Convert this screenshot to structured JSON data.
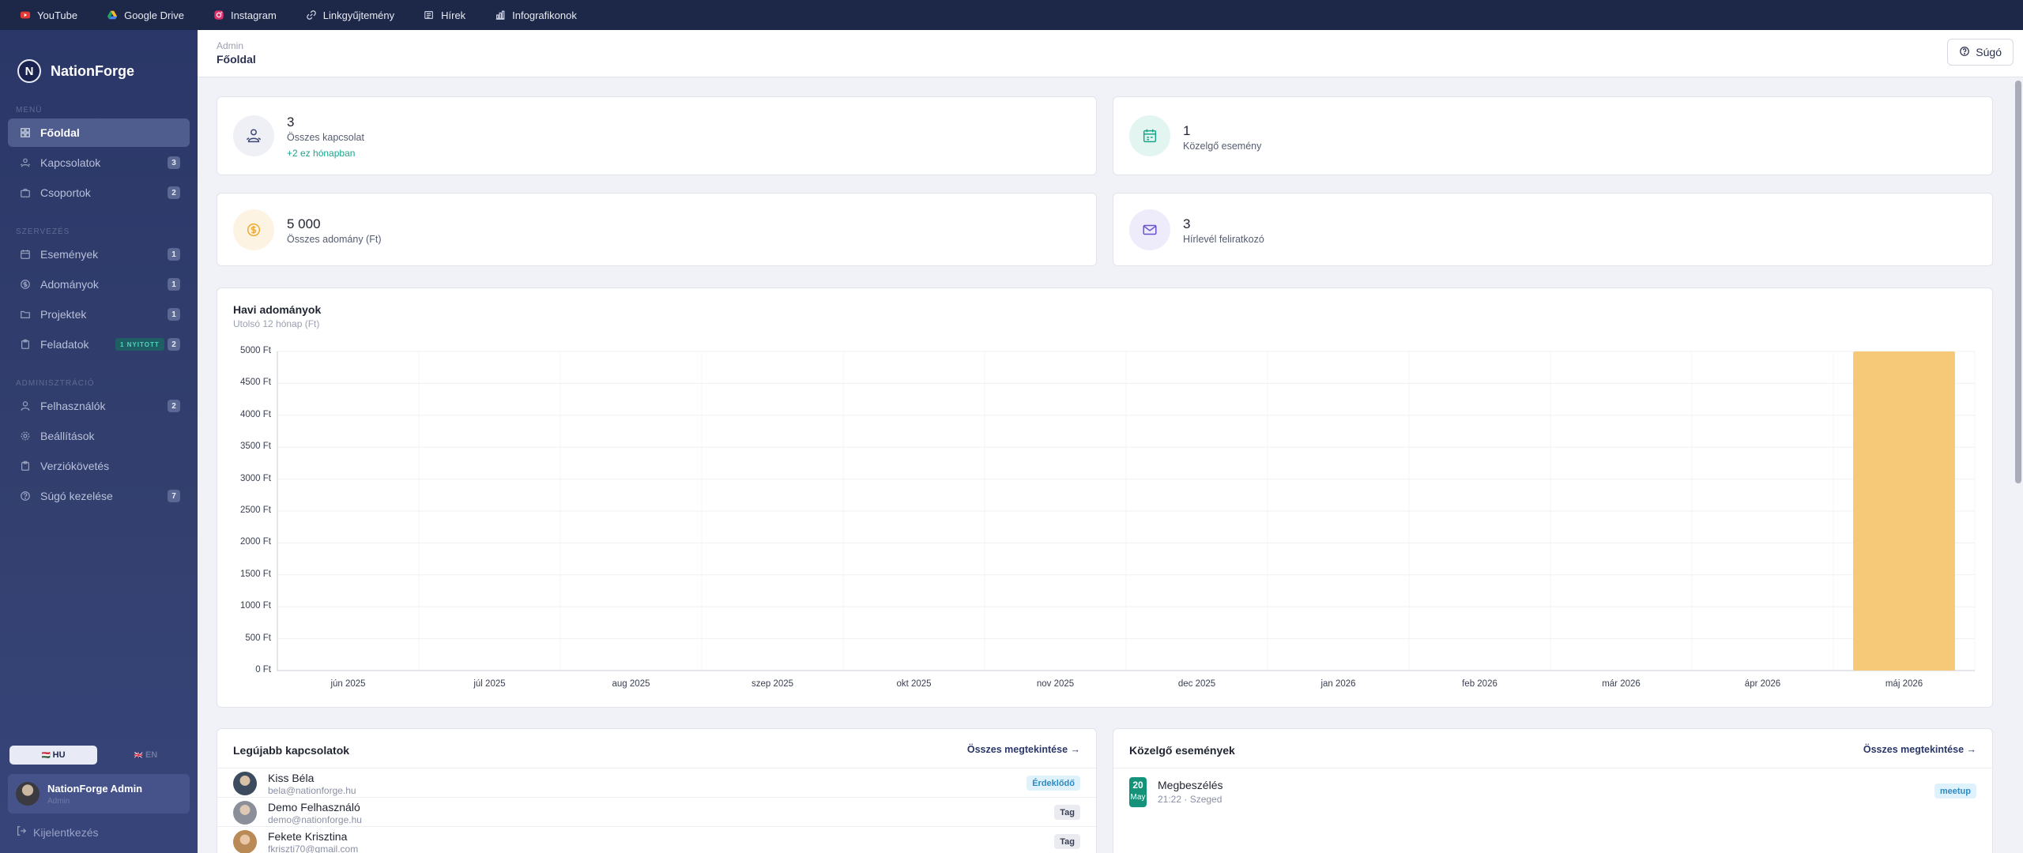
{
  "topbar": {
    "links": [
      {
        "label": "YouTube",
        "icon": "youtube-icon"
      },
      {
        "label": "Google Drive",
        "icon": "google-drive-icon"
      },
      {
        "label": "Instagram",
        "icon": "instagram-icon"
      },
      {
        "label": "Linkgyűjtemény",
        "icon": "link-icon"
      },
      {
        "label": "Hírek",
        "icon": "news-icon"
      },
      {
        "label": "Infografikonok",
        "icon": "bar-chart-icon"
      }
    ]
  },
  "sidebar": {
    "brand_letter": "N",
    "brand": "NationForge",
    "sections": {
      "menu": "MENÜ",
      "org": "SZERVEZÉS",
      "admin": "ADMINISZTRÁCIÓ"
    },
    "items": [
      {
        "label": "Főoldal",
        "icon": "dashboard-icon",
        "active": true
      },
      {
        "label": "Kapcsolatok",
        "icon": "contacts-icon",
        "badge": "3"
      },
      {
        "label": "Csoportok",
        "icon": "briefcase-icon",
        "badge": "2"
      },
      {
        "label": "Események",
        "icon": "calendar-icon",
        "badge": "1"
      },
      {
        "label": "Adományok",
        "icon": "coin-icon",
        "badge": "1"
      },
      {
        "label": "Projektek",
        "icon": "folder-icon",
        "badge": "1"
      },
      {
        "label": "Feladatok",
        "icon": "clipboard-icon",
        "badge": "2",
        "tag": "1 NYITOTT"
      },
      {
        "label": "Felhasználók",
        "icon": "user-icon",
        "badge": "2"
      },
      {
        "label": "Beállítások",
        "icon": "gear-icon"
      },
      {
        "label": "Verziókövetés",
        "icon": "clipboard-icon"
      },
      {
        "label": "Súgó kezelése",
        "icon": "help-icon",
        "badge": "7"
      }
    ],
    "lang_hu": "HU",
    "lang_en": "EN",
    "lang_hu_flag": "🇭🇺",
    "lang_en_flag": "🇬🇧",
    "user_name": "NationForge Admin",
    "user_role": "Admin",
    "logout": "Kijelentkezés"
  },
  "header": {
    "crumb_parent": "Admin",
    "crumb_current": "Főoldal",
    "help_label": "Súgó"
  },
  "stats": {
    "contacts": {
      "value": "3",
      "label": "Összes kapcsolat",
      "sub": "+2 ez hónapban"
    },
    "events": {
      "value": "1",
      "label": "Közelgő esemény"
    },
    "donations": {
      "value": "5 000",
      "label": "Összes adomány (Ft)"
    },
    "newsletter": {
      "value": "3",
      "label": "Hírlevél feliratkozó"
    }
  },
  "colors": {
    "accent": "#2a3768",
    "bar": "#f6c978",
    "teal": "#18a78d"
  },
  "chart_data": {
    "type": "bar",
    "title": "Havi adományok",
    "subtitle": "Utolsó 12 hónap (Ft)",
    "categories": [
      "jún 2025",
      "júl 2025",
      "aug 2025",
      "szep 2025",
      "okt 2025",
      "nov 2025",
      "dec 2025",
      "jan 2026",
      "feb 2026",
      "már 2026",
      "ápr 2026",
      "máj 2026"
    ],
    "values": [
      0,
      0,
      0,
      0,
      0,
      0,
      0,
      0,
      0,
      0,
      0,
      5000
    ],
    "ylim": [
      0,
      5000
    ],
    "yticks": [
      "0 Ft",
      "500 Ft",
      "1000 Ft",
      "1500 Ft",
      "2000 Ft",
      "2500 Ft",
      "3000 Ft",
      "3500 Ft",
      "4000 Ft",
      "4500 Ft",
      "5000 Ft"
    ],
    "grid": true
  },
  "contacts_panel": {
    "title": "Legújabb kapcsolatok",
    "link": "Összes megtekintése →",
    "rows": [
      {
        "name": "Kiss Béla",
        "email": "bela@nationforge.hu",
        "badge": "Érdeklődő"
      },
      {
        "name": "Demo Felhasználó",
        "email": "demo@nationforge.hu",
        "badge": "Tag"
      },
      {
        "name": "Fekete Krisztina",
        "email": "fkriszti70@gmail.com",
        "badge": "Tag"
      }
    ]
  },
  "events_panel": {
    "title": "Közelgő események",
    "link": "Összes megtekintése →",
    "rows": [
      {
        "day": "20",
        "month": "May",
        "title": "Megbeszélés",
        "meta": "21:22 · Szeged",
        "badge": "meetup"
      }
    ]
  }
}
